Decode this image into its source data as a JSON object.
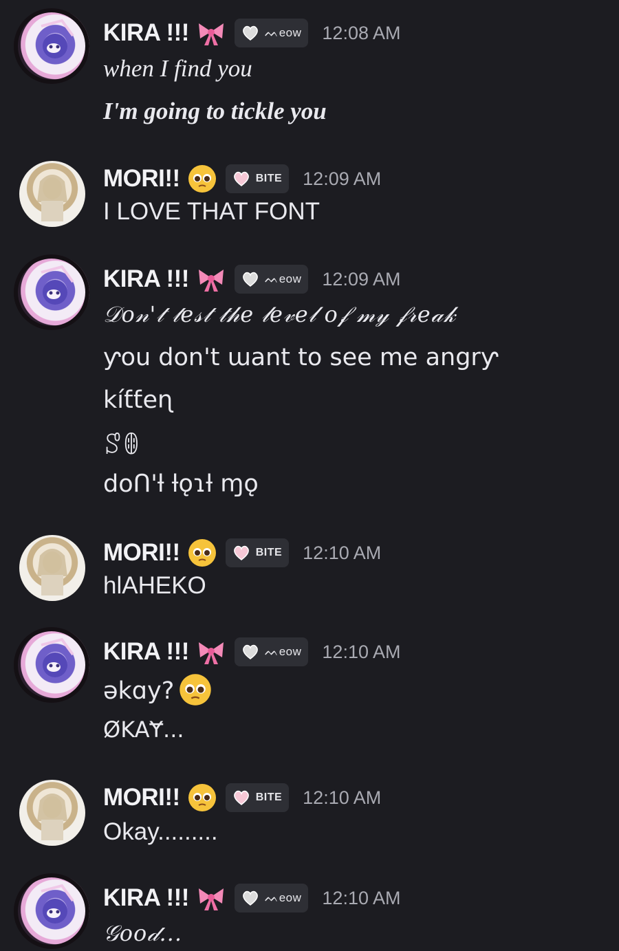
{
  "users": {
    "kira": {
      "name": "KIRA !!!",
      "emoji": "bow-emoji",
      "tag": "ᨓeow",
      "tag_icon": "gray-heart-icon"
    },
    "mori": {
      "name": "MORI!!",
      "emoji": "pleading-face-emoji",
      "tag": "BITE",
      "tag_icon": "pink-heart-icon"
    }
  },
  "messages": [
    {
      "author": "KIRA !!!",
      "tag": "ᨓeow",
      "time": "12:08 AM",
      "lines": [
        "when I find you",
        "I'm going to tickle you"
      ]
    },
    {
      "author": "MORI!!",
      "tag": "BITE",
      "time": "12:09 AM",
      "lines": [
        "I LOVE THAT FONT"
      ]
    },
    {
      "author": "KIRA !!!",
      "tag": "ᨓeow",
      "time": "12:09 AM",
      "lines": [
        "𝒟𝑜𝓃'𝓉 𝓉𝑒𝓈𝓉 𝓉𝒽𝑒 𝓁𝑒𝓋𝑒𝓁 𝑜𝒻 𝓂𝓎 𝒻𝓇𝑒𝒶𝓀",
        "ƴou don't ɯant to see me angrƴ",
        "kíƭƭeɳ",
        "ꑄꂦ",
        "dᴏᑎ'ƚ ƚǫɿƚ ɱǫ"
      ]
    },
    {
      "author": "MORI!!",
      "tag": "BITE",
      "time": "12:10 AM",
      "lines": [
        "hlAHEKO"
      ]
    },
    {
      "author": "KIRA !!!",
      "tag": "ᨓeow",
      "time": "12:10 AM",
      "lines": [
        "ǝkɑy?",
        "ØKAɎ..."
      ]
    },
    {
      "author": "MORI!!",
      "tag": "BITE",
      "time": "12:10 AM",
      "lines": [
        "Okay........."
      ]
    },
    {
      "author": "KIRA !!!",
      "tag": "ᨓeow",
      "time": "12:10 AM",
      "lines": [
        "𝒢𝑜𝑜𝒹..."
      ]
    }
  ],
  "colors": {
    "background": "#1c1c21",
    "tag_bg": "#2e2f35",
    "timestamp": "#a9aab2",
    "text": "#e9e9ee"
  }
}
